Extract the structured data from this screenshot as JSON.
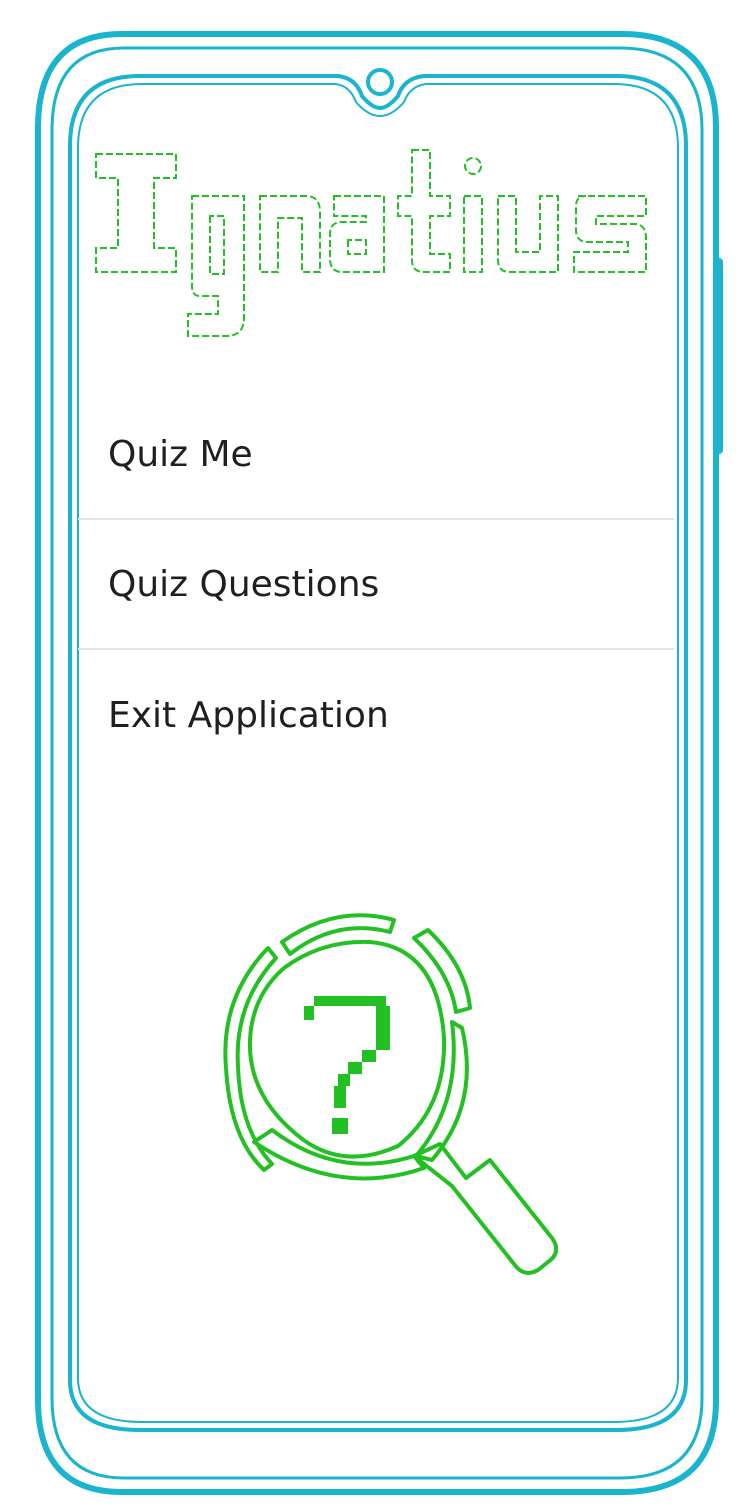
{
  "app": {
    "logo_text": "Ignatius",
    "logo_color": "#22c022",
    "frame_color": "#1ab4cf"
  },
  "menu": {
    "items": [
      {
        "label": "Quiz Me"
      },
      {
        "label": "Quiz Questions"
      },
      {
        "label": "Exit Application"
      }
    ]
  },
  "graphic": {
    "icon": "magnifier-question-icon",
    "glyph": "?"
  }
}
